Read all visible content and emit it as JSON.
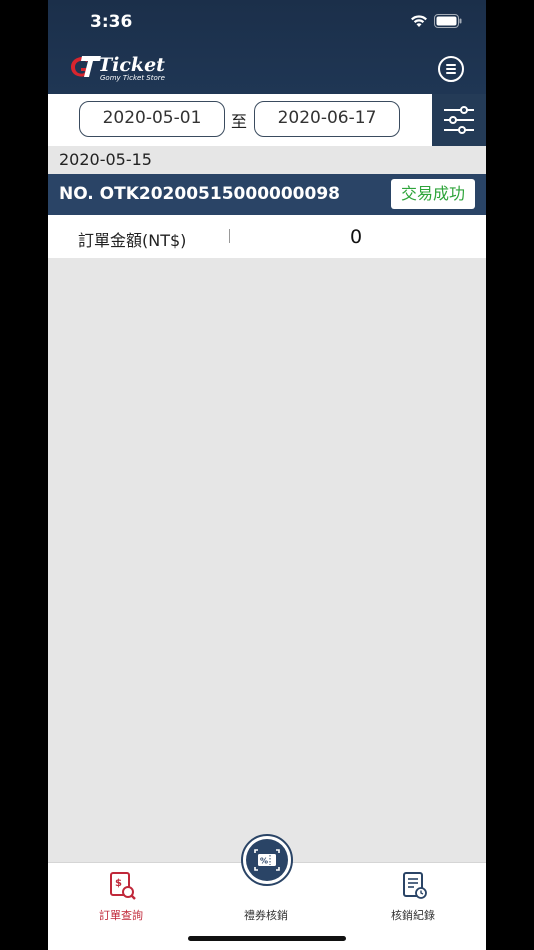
{
  "status_bar": {
    "time": "3:36"
  },
  "header": {
    "logo_text": "Ticket",
    "logo_sub": "Gomy Ticket Store"
  },
  "filter": {
    "date_from": "2020-05-01",
    "separator": "至",
    "date_to": "2020-06-17"
  },
  "orders": [
    {
      "date": "2020-05-15",
      "number": "NO.  OTK20200515000000098",
      "status": "交易成功",
      "amount_label": "訂單金額(NT$)",
      "amount": "0"
    }
  ],
  "tabbar": {
    "orders_label": "訂單查詢",
    "redeem_label": "禮券核銷",
    "history_label": "核銷紀錄"
  },
  "colors": {
    "navy": "#243b57",
    "accent_red": "#c0283a",
    "success_green": "#2ea43a"
  }
}
